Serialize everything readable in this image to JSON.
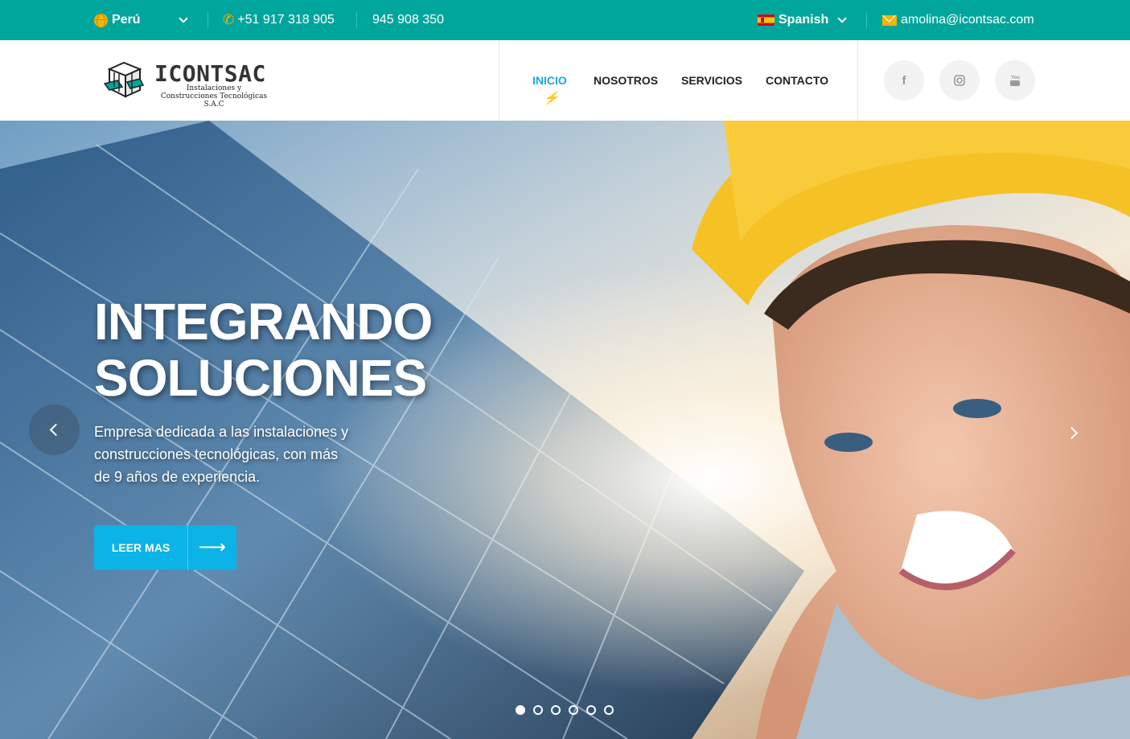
{
  "topbar": {
    "country": "Perú",
    "phone1": "+51 917 318 905",
    "phone2": "945 908 350",
    "language": "Spanish",
    "email": "amolina@icontsac.com"
  },
  "header": {
    "logo_title": "ICONTSAC",
    "logo_subtitle": "Instalaciones y Construcciones Tecnológicas S.A.C",
    "nav": [
      "INICIO",
      "NOSOTROS",
      "SERVICIOS",
      "CONTACTO"
    ],
    "active_nav": "INICIO",
    "social": [
      "facebook-icon",
      "instagram-icon",
      "youtube-icon"
    ]
  },
  "hero": {
    "title_line1": "INTEGRANDO",
    "title_line2": "SOLUCIONES",
    "description": "Empresa dedicada a las instalaciones y construcciones tecnológicas, con más de 9 años de experiencia.",
    "button_label": "LEER MAS",
    "slide_count": 6,
    "active_slide": 1
  },
  "colors": {
    "topbar": "#00a69c",
    "accent": "#1aa6e0",
    "button": "#0bb3e6",
    "icon_yellow": "#f5b400"
  }
}
